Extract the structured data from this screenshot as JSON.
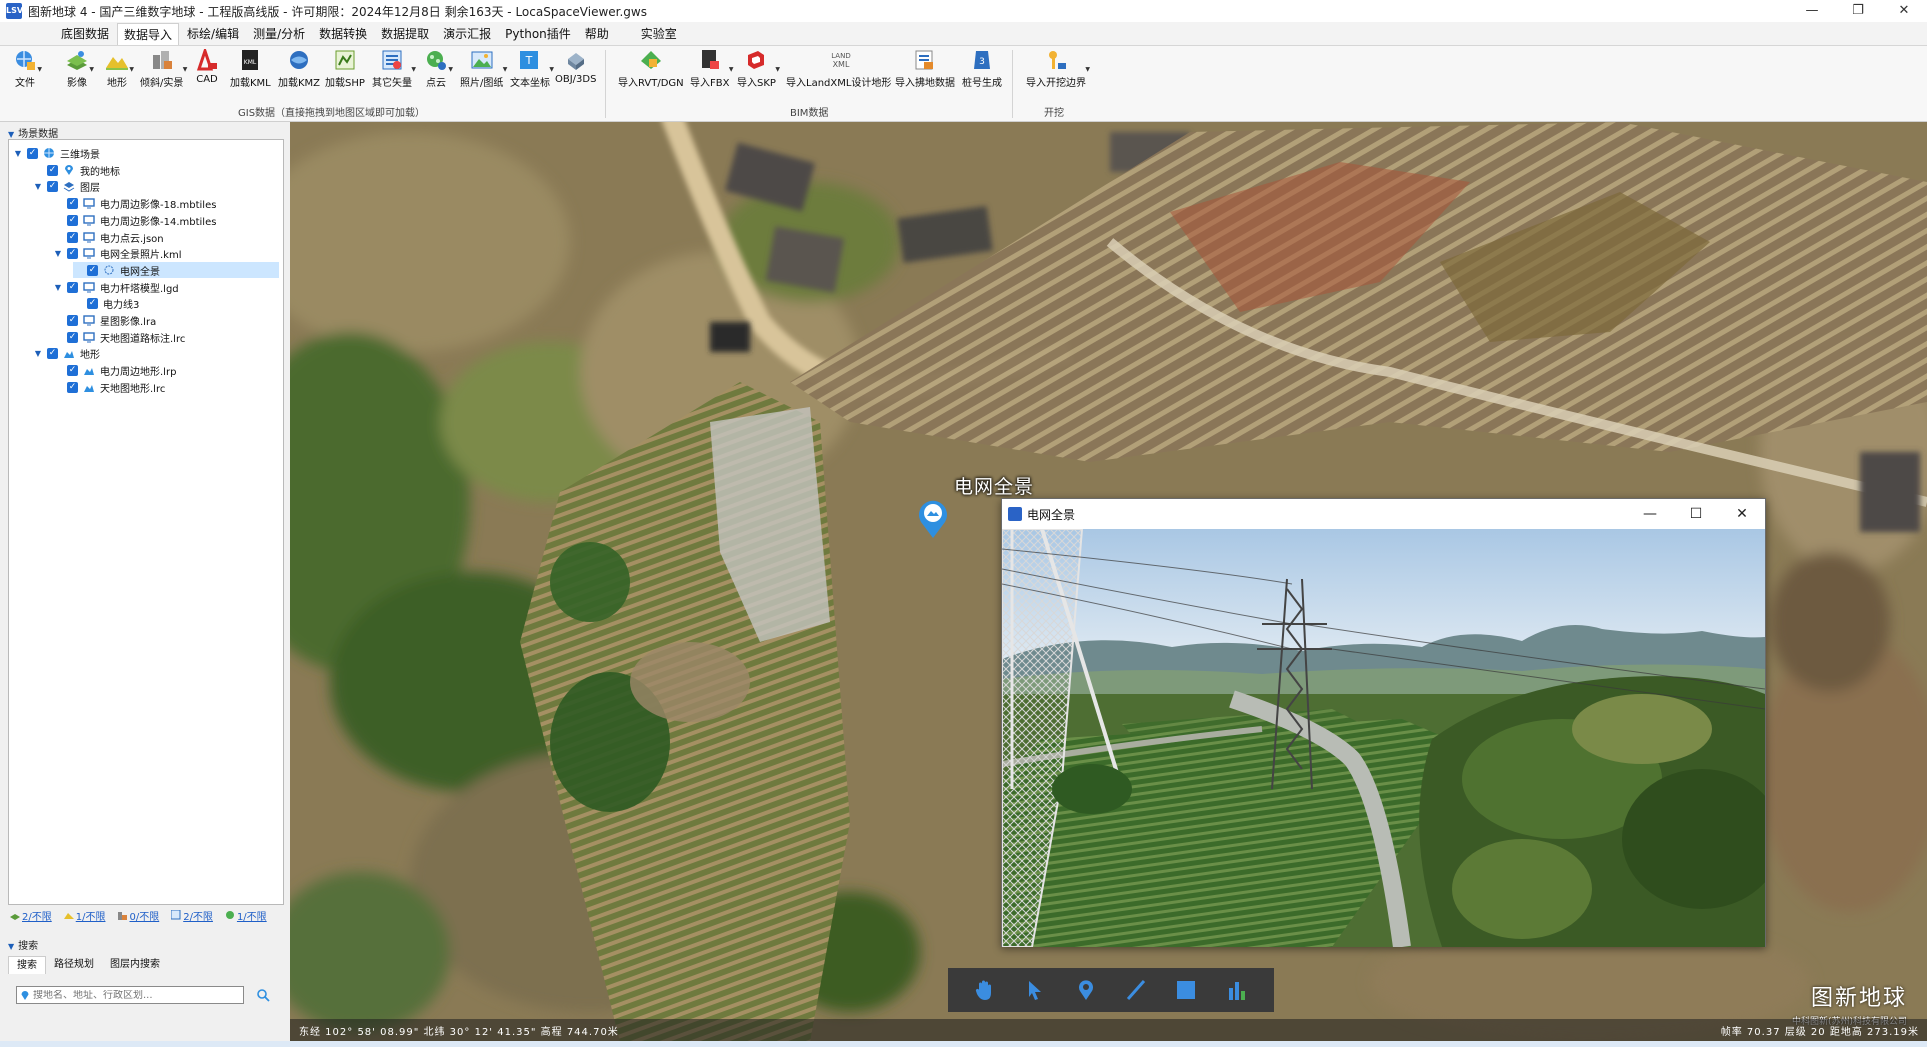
{
  "window": {
    "title": "图新地球 4 - 国产三维数字地球 - 工程版高线版 - 许可期限：2024年12月8日 剩余163天 - LocaSpaceViewer.gws",
    "app_icon": "LSV",
    "controls": [
      "—",
      "❐",
      "✕"
    ]
  },
  "menu": {
    "tabs": [
      "底图数据",
      "数据导入",
      "标绘/编辑",
      "测量/分析",
      "数据转换",
      "数据提取",
      "演示汇报",
      "Python插件",
      "帮助",
      "实验室"
    ],
    "active": "数据导入"
  },
  "ribbon": {
    "file_label": "文件",
    "gis_buttons": [
      {
        "label": "影像",
        "icon": "imagery-icon"
      },
      {
        "label": "地形",
        "icon": "terrain-icon"
      },
      {
        "label": "倾斜/实景",
        "icon": "oblique-icon"
      },
      {
        "label": "CAD",
        "icon": "cad-icon"
      },
      {
        "label": "加载KML",
        "icon": "kml-icon"
      },
      {
        "label": "加载KMZ",
        "icon": "kmz-icon"
      },
      {
        "label": "加载SHP",
        "icon": "shp-icon"
      },
      {
        "label": "其它矢量",
        "icon": "vector-icon"
      },
      {
        "label": "点云",
        "icon": "pointcloud-icon"
      },
      {
        "label": "照片/图纸",
        "icon": "photo-icon"
      },
      {
        "label": "文本坐标",
        "icon": "text-coord-icon"
      },
      {
        "label": "OBJ/3DS",
        "icon": "obj-icon"
      }
    ],
    "gis_group_label": "GIS数据（直接拖拽到地图区域即可加载）",
    "bim_buttons": [
      {
        "label": "导入RVT/DGN",
        "icon": "rvt-icon"
      },
      {
        "label": "导入FBX",
        "icon": "fbx-icon"
      },
      {
        "label": "导入SKP",
        "icon": "skp-icon"
      },
      {
        "label": "导入LandXML设计地形",
        "icon": "landxml-icon"
      },
      {
        "label": "导入拂地数据",
        "icon": "land-data-icon"
      },
      {
        "label": "桩号生成",
        "icon": "stake-icon"
      }
    ],
    "bim_group_label": "BIM数据",
    "excavation_buttons": [
      {
        "label": "导入开挖边界",
        "icon": "excavation-icon"
      }
    ],
    "excavation_group_label": "开挖",
    "landxml_icon_text": "LAND XML",
    "kml_icon_text": "KML"
  },
  "scene": {
    "header": "场景数据",
    "tree": [
      {
        "label": "三维场景",
        "level": 0,
        "expanded": true,
        "icon": "globe-icon"
      },
      {
        "label": "我的地标",
        "level": 1,
        "icon": "pin-icon"
      },
      {
        "label": "图层",
        "level": 1,
        "expanded": true,
        "icon": "layers-icon"
      },
      {
        "label": "电力周边影像-18.mbtiles",
        "level": 2,
        "icon": "monitor-icon"
      },
      {
        "label": "电力周边影像-14.mbtiles",
        "level": 2,
        "icon": "monitor-icon"
      },
      {
        "label": "电力点云.json",
        "level": 2,
        "icon": "monitor-icon"
      },
      {
        "label": "电网全景照片.kml",
        "level": 2,
        "expanded": true,
        "icon": "monitor-icon"
      },
      {
        "label": "电网全景",
        "level": 3,
        "selected": true,
        "icon": "panorama-icon"
      },
      {
        "label": "电力杆塔模型.lgd",
        "level": 2,
        "expanded": true,
        "icon": "monitor-icon"
      },
      {
        "label": "电力线3",
        "level": 3,
        "icon": ""
      },
      {
        "label": "星图影像.lra",
        "level": 2,
        "icon": "monitor-icon"
      },
      {
        "label": "天地图道路标注.lrc",
        "level": 2,
        "icon": "monitor-icon"
      },
      {
        "label": "地形",
        "level": 1,
        "expanded": true,
        "icon": "terrain-small-icon"
      },
      {
        "label": "电力周边地形.lrp",
        "level": 2,
        "icon": "terrain-small-icon"
      },
      {
        "label": "天地图地形.lrc",
        "level": 2,
        "icon": "terrain-small-icon"
      }
    ]
  },
  "stats": [
    "2/不限",
    "1/不限",
    "0/不限",
    "2/不限",
    "1/不限"
  ],
  "search": {
    "header": "搜索",
    "tabs": [
      "搜索",
      "路径规划",
      "图层内搜索"
    ],
    "active_tab": "搜索",
    "placeholder": "搜地名、地址、行政区划..."
  },
  "viewport": {
    "place_label": "电网全景",
    "status_coords": "东经 102° 58' 08.99\"  北纬 30° 12' 41.35\"  高程 744.70米",
    "status_right": "帧率 70.37  层级 20  距地高 273.19米",
    "brand_name": "图新地球",
    "brand_sub": "中科图新(苏州)科技有限公司",
    "tools": [
      "hand-pan-icon",
      "select-arrow-icon",
      "place-marker-icon",
      "draw-line-icon",
      "draw-polygon-icon",
      "terrain-analysis-icon"
    ]
  },
  "panorama_window": {
    "title": "电网全景",
    "controls": [
      "—",
      "☐",
      "✕"
    ]
  },
  "colors": {
    "accent": "#1f6fd6",
    "selection": "#cce6ff",
    "toolbar_bg": "#3a3a3a"
  }
}
